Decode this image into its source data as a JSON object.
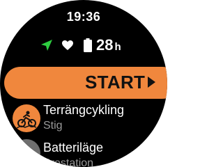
{
  "clock": {
    "time": "19:36"
  },
  "status": {
    "battery_value": "28",
    "battery_unit": "h",
    "icons": [
      "navigation-arrow-icon",
      "heart-icon",
      "battery-icon"
    ],
    "nav_color": "#2ecc40"
  },
  "start": {
    "label": "START",
    "color": "#f0873d"
  },
  "activity": {
    "title": "Terrängcykling",
    "subtitle": "Stig",
    "icon": "mountain-bike-icon"
  },
  "battery_mode": {
    "title": "Batteriläge",
    "subtitle": "Prestation",
    "icon": "battery-mode-icon"
  }
}
